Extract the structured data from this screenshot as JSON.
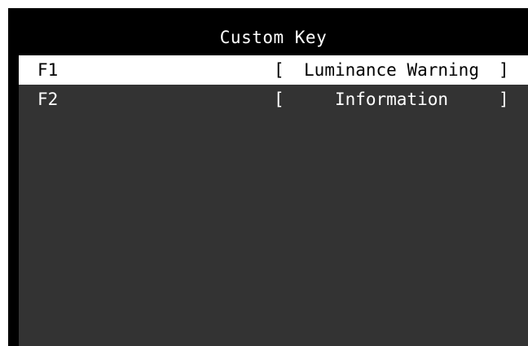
{
  "menu": {
    "title": "Custom Key",
    "items": [
      {
        "key": "F1",
        "bracket_open": "[",
        "value": "Luminance Warning",
        "bracket_close": "]",
        "selected": true
      },
      {
        "key": "F2",
        "bracket_open": "[",
        "value": "Information",
        "bracket_close": "]",
        "selected": false
      }
    ]
  },
  "colors": {
    "frame": "#000000",
    "panel": "#333333",
    "title_bar": "#000000",
    "selected_row": "#ffffff",
    "text": "#ffffff",
    "selected_text": "#000000"
  }
}
